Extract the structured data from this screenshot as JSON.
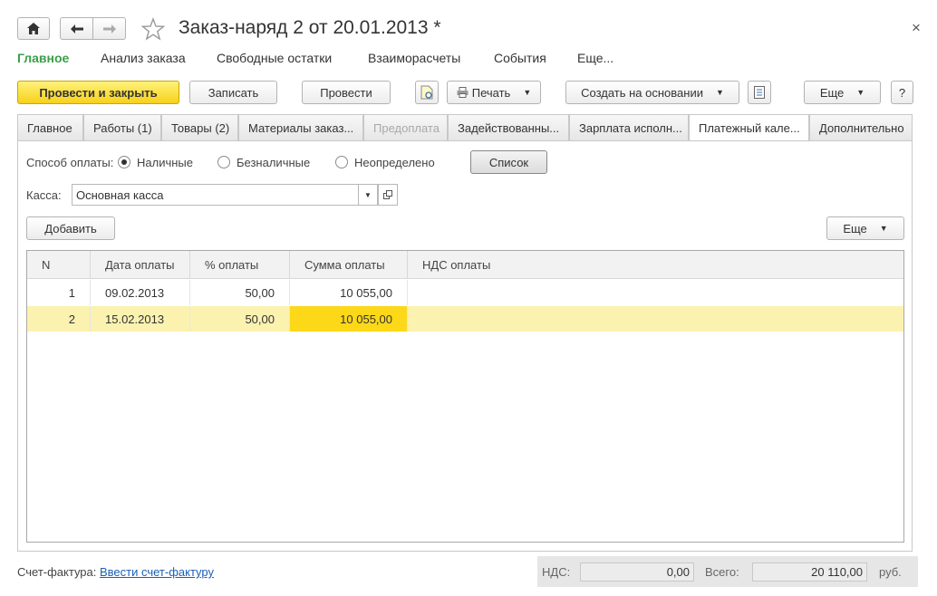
{
  "window": {
    "title": "Заказ-наряд 2 от 20.01.2013 *",
    "close_glyph": "×"
  },
  "nav": {
    "items": [
      "Главное",
      "Анализ заказа",
      "Свободные остатки",
      "Взаиморасчеты",
      "События",
      "Еще..."
    ]
  },
  "toolbar": {
    "post_close": "Провести и закрыть",
    "save": "Записать",
    "post": "Провести",
    "print": "Печать",
    "create_based": "Создать на основании",
    "more": "Еще",
    "help": "?"
  },
  "tabs": [
    "Главное",
    "Работы (1)",
    "Товары (2)",
    "Материалы заказ...",
    "Предоплата",
    "Задействованны...",
    "Зарплата исполн...",
    "Платежный кале...",
    "Дополнительно"
  ],
  "payment": {
    "method_label": "Способ оплаты:",
    "options": [
      "Наличные",
      "Безналичные",
      "Неопределено"
    ],
    "selected": "Наличные",
    "list_button": "Список",
    "cash_label": "Касса:",
    "cash_value": "Основная касса"
  },
  "table": {
    "add_button": "Добавить",
    "more_button": "Еще",
    "columns": [
      "N",
      "Дата оплаты",
      "% оплаты",
      "Сумма оплаты",
      "НДС оплаты"
    ],
    "rows": [
      {
        "n": "1",
        "date": "09.02.2013",
        "percent": "50,00",
        "sum": "10 055,00",
        "vat": ""
      },
      {
        "n": "2",
        "date": "15.02.2013",
        "percent": "50,00",
        "sum": "10 055,00",
        "vat": ""
      }
    ],
    "selected_row_color": "#fbf2b0",
    "selected_cell_color": "#fcd818"
  },
  "footer": {
    "invoice_label": "Счет-фактура:",
    "invoice_link": "Ввести счет-фактуру",
    "vat_label": "НДС:",
    "vat_value": "0,00",
    "total_label": "Всего:",
    "total_value": "20 110,00",
    "currency": "руб."
  },
  "colors": {
    "accent_green": "#3a9e4a",
    "link_blue": "#1b5fb5",
    "primary_button": "#f7d11a"
  }
}
